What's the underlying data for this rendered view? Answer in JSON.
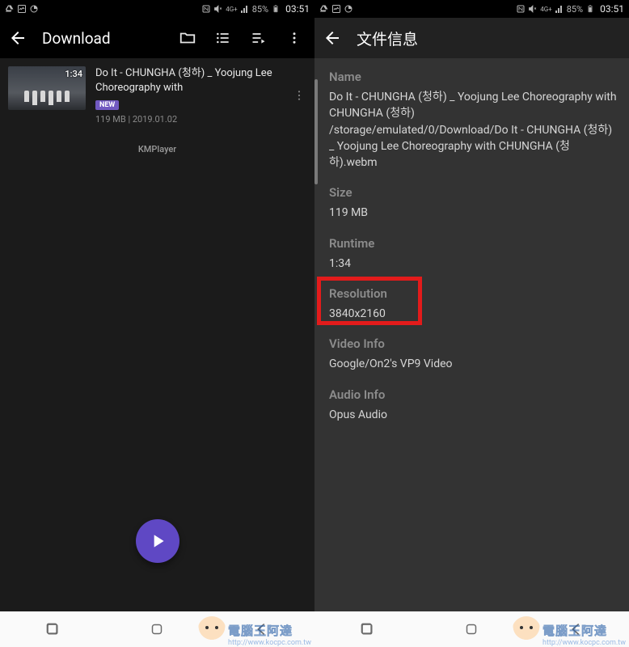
{
  "status": {
    "battery_pct": "85%",
    "clock": "03:51",
    "net": "4G+"
  },
  "left": {
    "title": "Download",
    "item": {
      "duration": "1:34",
      "title": "Do It - CHUNGHA (청하) _ Yoojung Lee Choreography with",
      "badge": "NEW",
      "meta": "119 MB | 2019.01.02"
    },
    "brand": "KMPlayer"
  },
  "right": {
    "title": "文件信息",
    "name_label": "Name",
    "name_value": "Do It - CHUNGHA (청하) _ Yoojung Lee Choreography with CHUNGHA (청하)\n/storage/emulated/0/Download/Do It - CHUNGHA (청하) _ Yoojung Lee Choreography with CHUNGHA (청하).webm",
    "size_label": "Size",
    "size_value": "119 MB",
    "runtime_label": "Runtime",
    "runtime_value": "1:34",
    "resolution_label": "Resolution",
    "resolution_value": "3840x2160",
    "videoinfo_label": "Video Info",
    "videoinfo_value": "Google/On2's VP9 Video",
    "audioinfo_label": "Audio Info",
    "audioinfo_value": "Opus Audio"
  },
  "watermark": {
    "main": "電腦王阿達",
    "sub": "http://www.kocpc.com.tw"
  }
}
